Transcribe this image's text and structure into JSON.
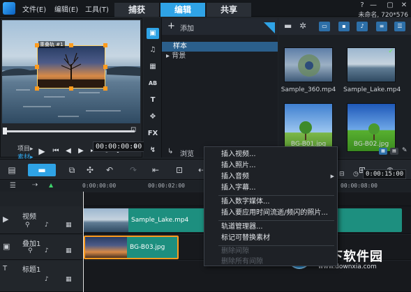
{
  "menu": {
    "file": "文件(E)",
    "edit": "编辑(E)",
    "tools": "工具(T)"
  },
  "tabs": [
    {
      "label": "捕获",
      "active": false
    },
    {
      "label": "编辑",
      "active": true
    },
    {
      "label": "共享",
      "active": false
    }
  ],
  "project": {
    "info": "未命名, 720*576"
  },
  "preview": {
    "overlay_label": "重叠轨 #1",
    "mode_project": "项目▸",
    "mode_clip": "素材▸",
    "timecode": "00:00:00:00"
  },
  "library": {
    "add_label": "添加",
    "folders": [
      {
        "label": "样本",
        "selected": true
      },
      {
        "label": "▸ 背景",
        "selected": false
      }
    ],
    "browse_label": "浏览",
    "items": [
      {
        "label": "Sample_360.mp4",
        "checked": false
      },
      {
        "label": "Sample_Lake.mp4",
        "checked": true
      },
      {
        "label": "BG-B01.jpg",
        "checked": false
      },
      {
        "label": "BG-B02.jpg",
        "checked": false
      }
    ]
  },
  "sidebar": {
    "icons": [
      "media-icon",
      "transition-icon",
      "title-icon",
      "graphic-icon",
      "filter-icon",
      "fx-icon",
      "path-icon"
    ],
    "labels": [
      "",
      "",
      "AB",
      "T",
      "",
      "FX",
      ""
    ]
  },
  "timeline": {
    "ruler": [
      "0:00:00:00",
      "00:00:02:00",
      "00:00:08:00"
    ],
    "right_timecode": "0:00:15:00",
    "tracks": [
      {
        "name": "视频",
        "clip": "Sample_Lake.mp4"
      },
      {
        "name": "叠加1",
        "clip": "BG-B03.jpg"
      },
      {
        "name": "标题1",
        "clip": ""
      }
    ]
  },
  "context_menu": {
    "items": [
      {
        "label": "插入视频...",
        "enabled": true,
        "submenu": false
      },
      {
        "label": "插入照片...",
        "enabled": true,
        "submenu": false
      },
      {
        "label": "插入音频",
        "enabled": true,
        "submenu": true
      },
      {
        "label": "插入字幕...",
        "enabled": true,
        "submenu": false
      },
      {
        "label": "插入数字媒体...",
        "enabled": true,
        "submenu": false
      },
      {
        "label": "插入要应用时间流逝/频闪的照片...",
        "enabled": true,
        "submenu": false
      },
      {
        "label": "轨道管理器...",
        "enabled": true,
        "submenu": false
      },
      {
        "label": "标记可替换素材",
        "enabled": true,
        "submenu": false
      },
      {
        "label": "删除间隙",
        "enabled": false,
        "submenu": false
      },
      {
        "label": "删除所有间隙",
        "enabled": false,
        "submenu": false
      }
    ]
  },
  "watermark": {
    "title": "当下软件园",
    "url": "www.downxia.com"
  },
  "colors": {
    "accent": "#2fa3e6",
    "clip_video": "#1d8f7f",
    "clip_overlay": "#1d8f7f",
    "overlay_border": "#ff9b1e"
  }
}
